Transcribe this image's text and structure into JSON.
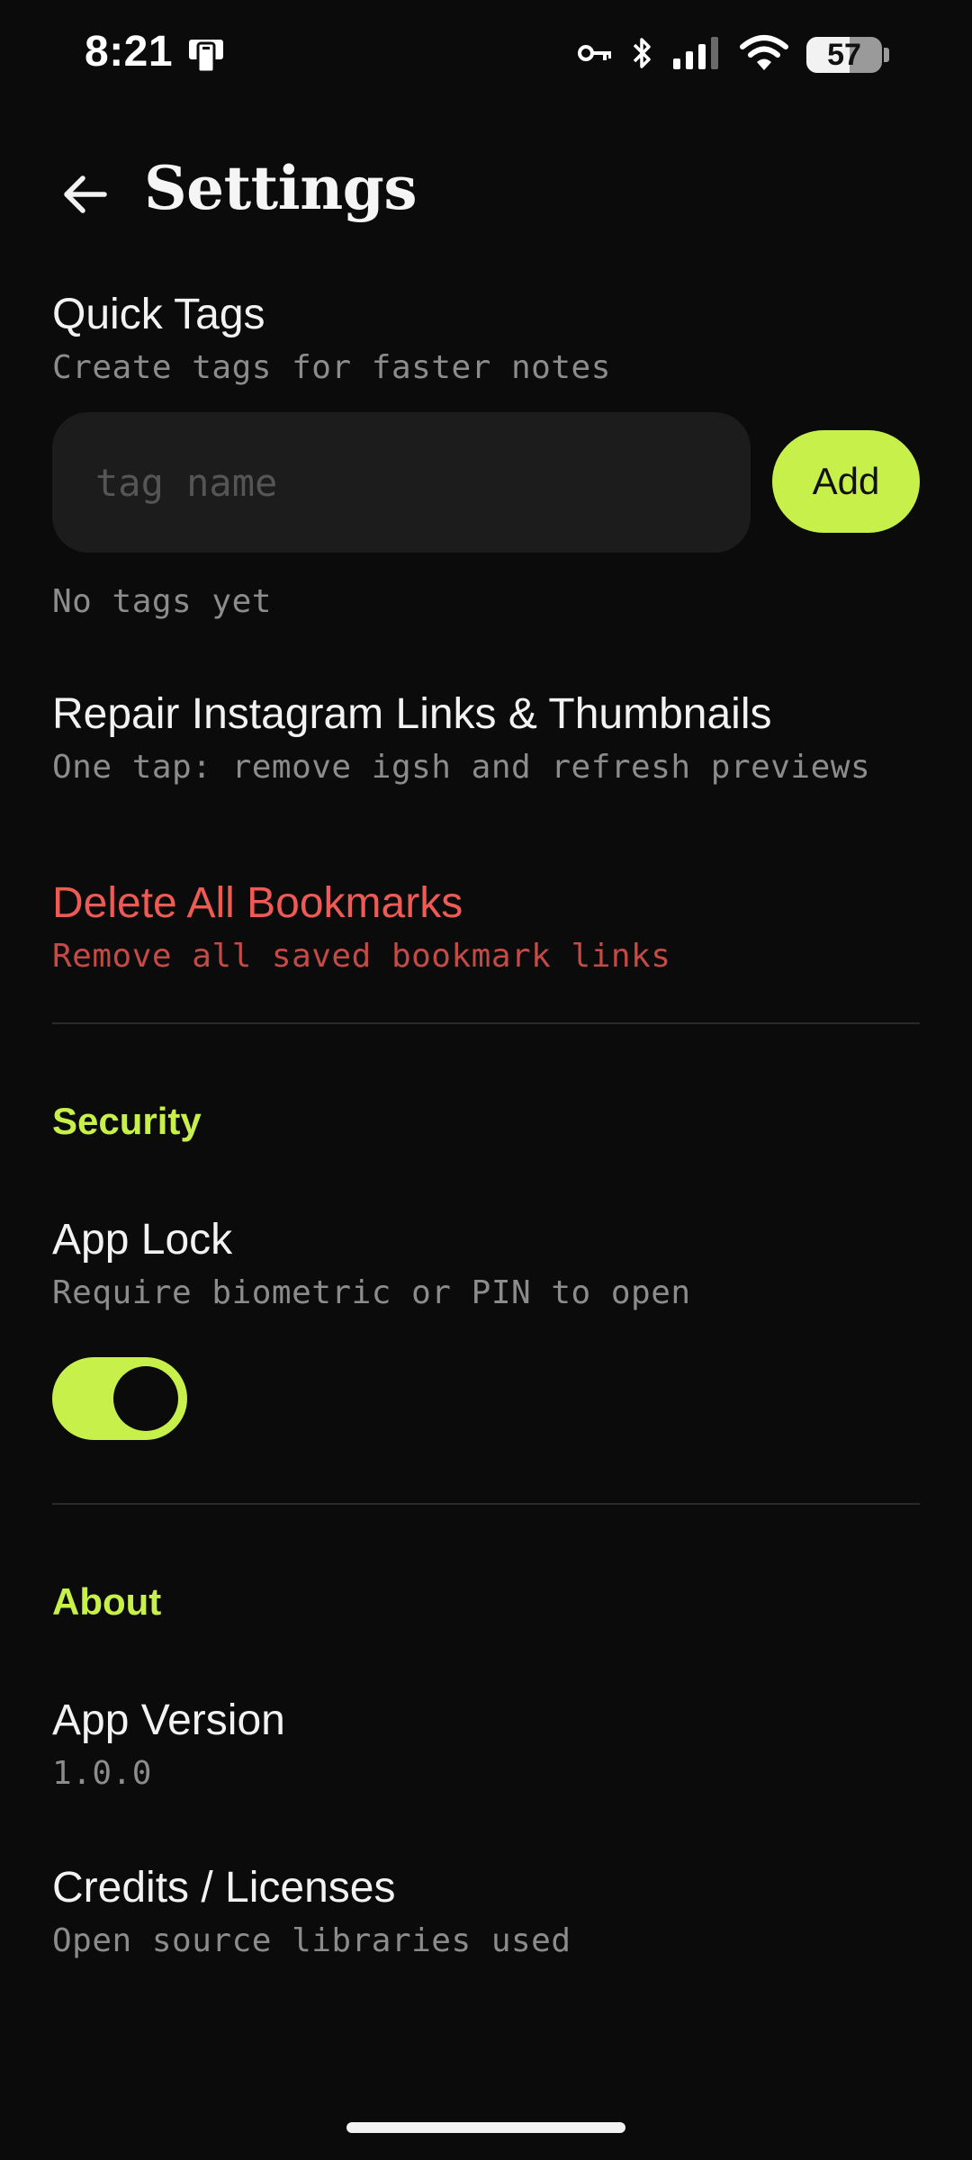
{
  "status_bar": {
    "time": "8:21",
    "battery": "57",
    "icons": [
      "phone-icon",
      "key-icon",
      "bluetooth-icon",
      "signal-icon",
      "wifi-icon",
      "battery-icon"
    ]
  },
  "header": {
    "title": "Settings",
    "back_icon": "arrow-left-icon"
  },
  "quick_tags": {
    "title": "Quick Tags",
    "subtitle": "Create tags for faster notes",
    "input_placeholder": "tag name",
    "input_value": "",
    "add_label": "Add",
    "empty_text": "No tags yet"
  },
  "repair": {
    "title": "Repair Instagram Links & Thumbnails",
    "subtitle": "One tap: remove igsh and refresh previews"
  },
  "delete_all": {
    "title": "Delete All Bookmarks",
    "subtitle": "Remove all saved bookmark links"
  },
  "security": {
    "label": "Security",
    "app_lock_title": "App Lock",
    "app_lock_subtitle": "Require biometric or PIN to open",
    "app_lock_enabled": true
  },
  "about": {
    "label": "About",
    "version_title": "App Version",
    "version_value": "1.0.0",
    "credits_title": "Credits / Licenses",
    "credits_subtitle": "Open source libraries used"
  },
  "colors": {
    "background": "#0b0b0b",
    "accent": "#c8f04a",
    "danger": "#f05a55",
    "muted": "#8c8c8c"
  }
}
